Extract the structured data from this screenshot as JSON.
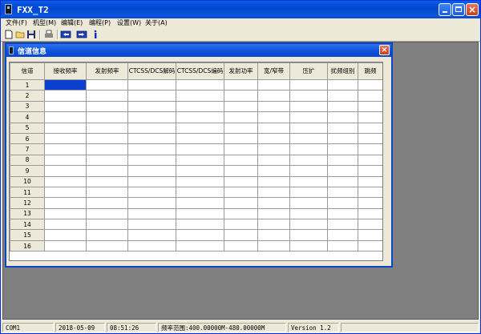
{
  "window": {
    "title": "FXX_T2",
    "menus": [
      "文件(F)",
      "机型(M)",
      "编辑(E)",
      "编程(P)",
      "设置(W)",
      "关于(A)"
    ]
  },
  "toolbar": {
    "icons": [
      "new-file-icon",
      "open-folder-icon",
      "save-icon",
      "print-icon",
      "read-radio-icon",
      "write-radio-icon",
      "info-icon"
    ]
  },
  "channel_window": {
    "title": "信道信息",
    "columns": [
      "信道",
      "接收频率",
      "发射频率",
      "CTCSS/DCS解码",
      "CTCSS/DCS编码",
      "发射功率",
      "宽/窄带",
      "压扩",
      "扰频组别",
      "跳频"
    ],
    "rows": [
      "1",
      "2",
      "3",
      "4",
      "5",
      "6",
      "7",
      "8",
      "9",
      "10",
      "11",
      "12",
      "13",
      "14",
      "15",
      "16"
    ]
  },
  "status": {
    "port": "COM1",
    "date": "2018-05-09",
    "time": "08:51:26",
    "freq_range": "频率范围:400.00000M-480.00000M",
    "version": "Version 1.2"
  }
}
